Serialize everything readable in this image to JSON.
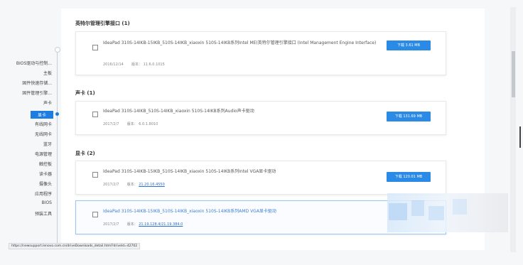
{
  "nav": {
    "items": [
      {
        "label": "BIOS驱动与控制...",
        "y": 0
      },
      {
        "label": "主板",
        "y": 0
      },
      {
        "label": "固件快速存储...",
        "y": 0
      },
      {
        "label": "固件管理引擎...",
        "y": 0
      },
      {
        "label": "声卡",
        "y": 0
      },
      {
        "label": "显卡",
        "y": 0,
        "active": true
      },
      {
        "label": "有线网卡",
        "y": 0
      },
      {
        "label": "无线网卡",
        "y": 0
      },
      {
        "label": "蓝牙",
        "y": 0
      },
      {
        "label": "电源管理",
        "y": 0
      },
      {
        "label": "触控板",
        "y": 0
      },
      {
        "label": "读卡器",
        "y": 0
      },
      {
        "label": "摄像头",
        "y": 0
      },
      {
        "label": "应用程序",
        "y": 0
      },
      {
        "label": "BIOS",
        "y": 0
      },
      {
        "label": "预装工具",
        "y": 0
      }
    ]
  },
  "sections": {
    "mei": {
      "title": "英特尔管理引擎接口 (1)",
      "driver": {
        "name": "IdeaPad 310S-14IKB-15IKB_510S-14IKB_xiaoxin 510S-14IKB系列Intel ME(英特尔管理引擎接口 (Intel Management Engine Interface)",
        "date": "2016/12/14",
        "version_label": "版本：",
        "version": "11.6.0.1015",
        "download": "下载 3.61 MB"
      }
    },
    "audio": {
      "title": "声卡 (1)",
      "driver": {
        "name": "IdeaPad 310S-14IKB_510S-14IKB_xiaoxin 510S-14IKB系列Audio声卡驱动",
        "date": "2017/2/7",
        "version_label": "版本：",
        "version": "6.0.1.8010",
        "download": "下载 131.69 MB"
      }
    },
    "video": {
      "title": "显卡 (2)",
      "drivers": [
        {
          "name": "IdeaPad 310S-14IKB-15IKB_510S-14IKB_xiaoxin 510S-14IKB系列Intel VGA显卡驱动",
          "date": "2017/2/7",
          "version_label": "版本：",
          "version": "21.20.16.4550",
          "download": "下载 120.01 MB"
        },
        {
          "name": "IdeaPad 310S-14IKB-15IKB_510S-14IKB_xiaoxin 510S-14IKB系列AMD VGA显卡驱动",
          "date": "2017/2/7",
          "version_label": "版本：",
          "version": "21.19.128.4/21.19.384.0",
          "download": ""
        }
      ]
    }
  },
  "status_bar": {
    "url": "https://newsupport.lenovo.com.cn/driveDownloads_detail.html?driveId=42702"
  }
}
